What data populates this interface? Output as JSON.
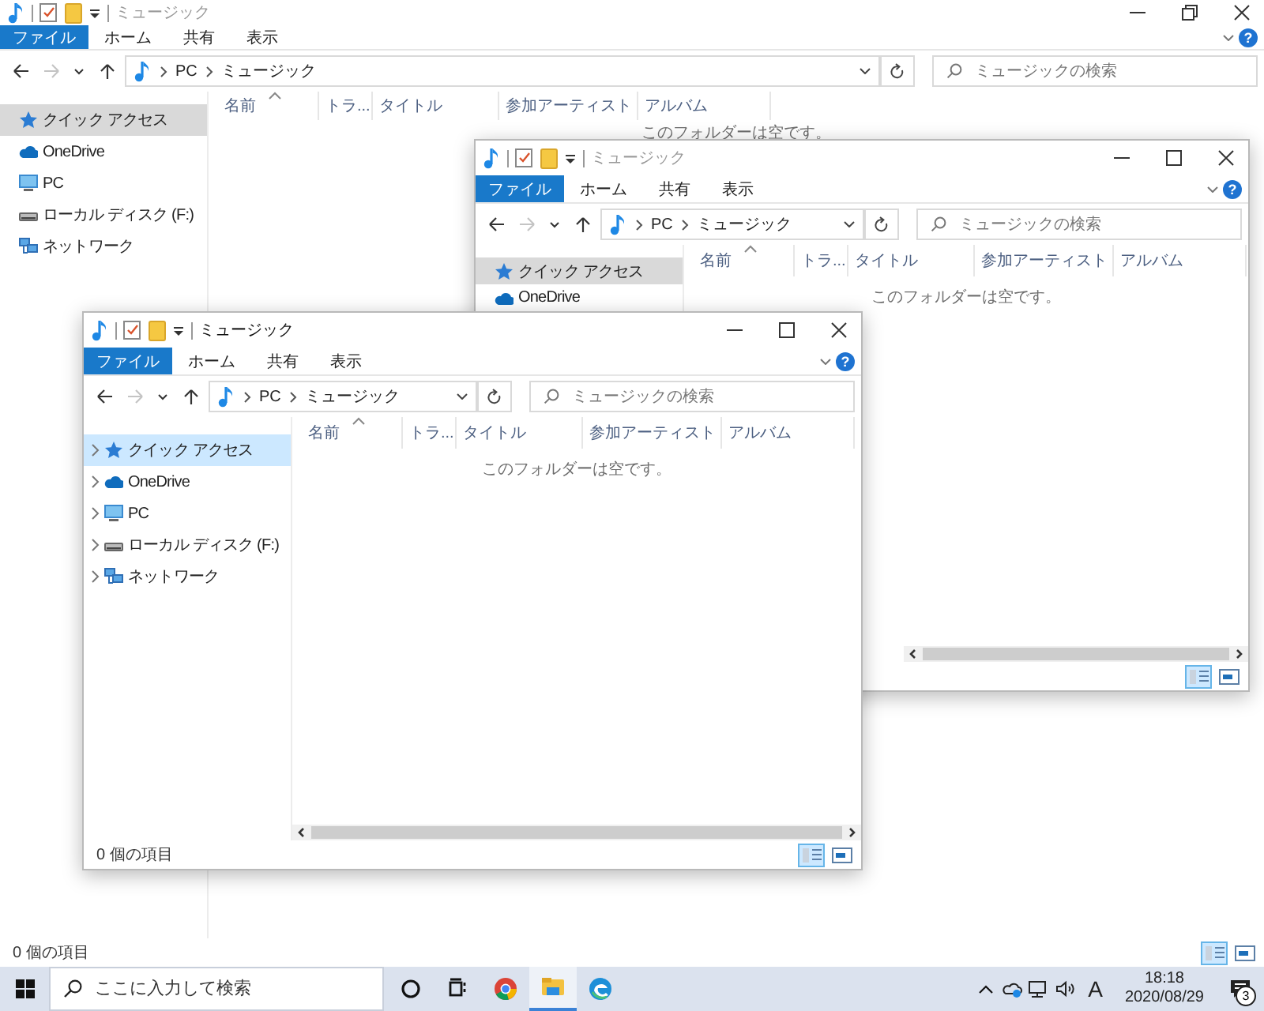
{
  "windows": [
    {
      "title": "ミュージック",
      "active": false,
      "maximized": true,
      "ribbon_tabs": [
        {
          "label": "ファイル",
          "kind": "file"
        },
        {
          "label": "ホーム",
          "kind": "tab"
        },
        {
          "label": "共有",
          "kind": "tab"
        },
        {
          "label": "表示",
          "kind": "tab"
        }
      ],
      "help": "?",
      "nav_buttons": [
        {
          "kind": "back",
          "disabled": false
        },
        {
          "kind": "forward",
          "disabled": true
        },
        {
          "kind": "recent",
          "disabled": false
        },
        {
          "kind": "up",
          "disabled": false
        }
      ],
      "address": [
        "PC",
        "ミュージック"
      ],
      "search": {
        "placeholder": "ミュージックの検索"
      },
      "columns": [
        {
          "label": "名前",
          "sorted": true
        },
        {
          "label": "トラ...",
          "sorted": false
        },
        {
          "label": "タイトル",
          "sorted": false
        },
        {
          "label": "参加アーティスト",
          "sorted": false
        },
        {
          "label": "アルバム",
          "sorted": false
        }
      ],
      "sidebar": [
        {
          "label": "クイック アクセス",
          "kind": "quick-access",
          "selected": true
        },
        {
          "label": "OneDrive",
          "kind": "cloud",
          "selected": false
        },
        {
          "label": "PC",
          "kind": "pc",
          "selected": false
        },
        {
          "label": "ローカル ディスク (F:)",
          "kind": "drive",
          "selected": false
        },
        {
          "label": "ネットワーク",
          "kind": "network",
          "selected": false
        }
      ],
      "empty_message": "このフォルダーは空です。",
      "h_scrollbar": false,
      "status": "0 個の項目",
      "view_buttons": [
        {
          "kind": "details",
          "selected": true
        },
        {
          "kind": "preview",
          "selected": false
        }
      ]
    },
    {
      "title": "ミュージック",
      "active": false,
      "maximized": false,
      "ribbon_tabs": [
        {
          "label": "ファイル",
          "kind": "file"
        },
        {
          "label": "ホーム",
          "kind": "tab"
        },
        {
          "label": "共有",
          "kind": "tab"
        },
        {
          "label": "表示",
          "kind": "tab"
        }
      ],
      "help": "?",
      "nav_buttons": [
        {
          "kind": "back",
          "disabled": false
        },
        {
          "kind": "forward",
          "disabled": true
        },
        {
          "kind": "recent",
          "disabled": false
        },
        {
          "kind": "up",
          "disabled": false
        }
      ],
      "address": [
        "PC",
        "ミュージック"
      ],
      "search": {
        "placeholder": "ミュージックの検索"
      },
      "columns": [
        {
          "label": "名前",
          "sorted": true
        },
        {
          "label": "トラ...",
          "sorted": false
        },
        {
          "label": "タイトル",
          "sorted": false
        },
        {
          "label": "参加アーティスト",
          "sorted": false
        },
        {
          "label": "アルバム",
          "sorted": false
        }
      ],
      "sidebar": [
        {
          "label": "クイック アクセス",
          "kind": "quick-access",
          "selected": true
        },
        {
          "label": "OneDrive",
          "kind": "cloud",
          "selected": false
        }
      ],
      "empty_message": "このフォルダーは空です。",
      "h_scrollbar": true,
      "view_buttons": [
        {
          "kind": "details",
          "selected": true
        },
        {
          "kind": "preview",
          "selected": false
        }
      ]
    },
    {
      "title": "ミュージック",
      "active": true,
      "maximized": false,
      "ribbon_tabs": [
        {
          "label": "ファイル",
          "kind": "file"
        },
        {
          "label": "ホーム",
          "kind": "tab"
        },
        {
          "label": "共有",
          "kind": "tab"
        },
        {
          "label": "表示",
          "kind": "tab"
        }
      ],
      "help": "?",
      "nav_buttons": [
        {
          "kind": "back",
          "disabled": false
        },
        {
          "kind": "forward",
          "disabled": true
        },
        {
          "kind": "recent",
          "disabled": false
        },
        {
          "kind": "up",
          "disabled": false
        }
      ],
      "address": [
        "PC",
        "ミュージック"
      ],
      "search": {
        "placeholder": "ミュージックの検索"
      },
      "columns": [
        {
          "label": "名前",
          "sorted": true
        },
        {
          "label": "トラ...",
          "sorted": false
        },
        {
          "label": "タイトル",
          "sorted": false
        },
        {
          "label": "参加アーティスト",
          "sorted": false
        },
        {
          "label": "アルバム",
          "sorted": false
        }
      ],
      "sidebar": [
        {
          "label": "クイック アクセス",
          "kind": "quick-access",
          "selected": true
        },
        {
          "label": "OneDrive",
          "kind": "cloud",
          "selected": false
        },
        {
          "label": "PC",
          "kind": "pc",
          "selected": false
        },
        {
          "label": "ローカル ディスク (F:)",
          "kind": "drive",
          "selected": false
        },
        {
          "label": "ネットワーク",
          "kind": "network",
          "selected": false
        }
      ],
      "empty_message": "このフォルダーは空です。",
      "h_scrollbar": true,
      "status": "0 個の項目",
      "view_buttons": [
        {
          "kind": "details",
          "selected": true
        },
        {
          "kind": "preview",
          "selected": false
        }
      ]
    }
  ],
  "taskbar": {
    "search": {
      "placeholder": "ここに入力して検索"
    },
    "pinned": [
      {
        "kind": "cortana",
        "running": false
      },
      {
        "kind": "task-view",
        "running": false
      },
      {
        "kind": "chrome",
        "running": false
      },
      {
        "kind": "explorer",
        "running": true
      },
      {
        "kind": "edge",
        "running": false
      }
    ],
    "ime": "A",
    "time": "18:18",
    "date": "2020/08/29",
    "notifications": "3"
  }
}
